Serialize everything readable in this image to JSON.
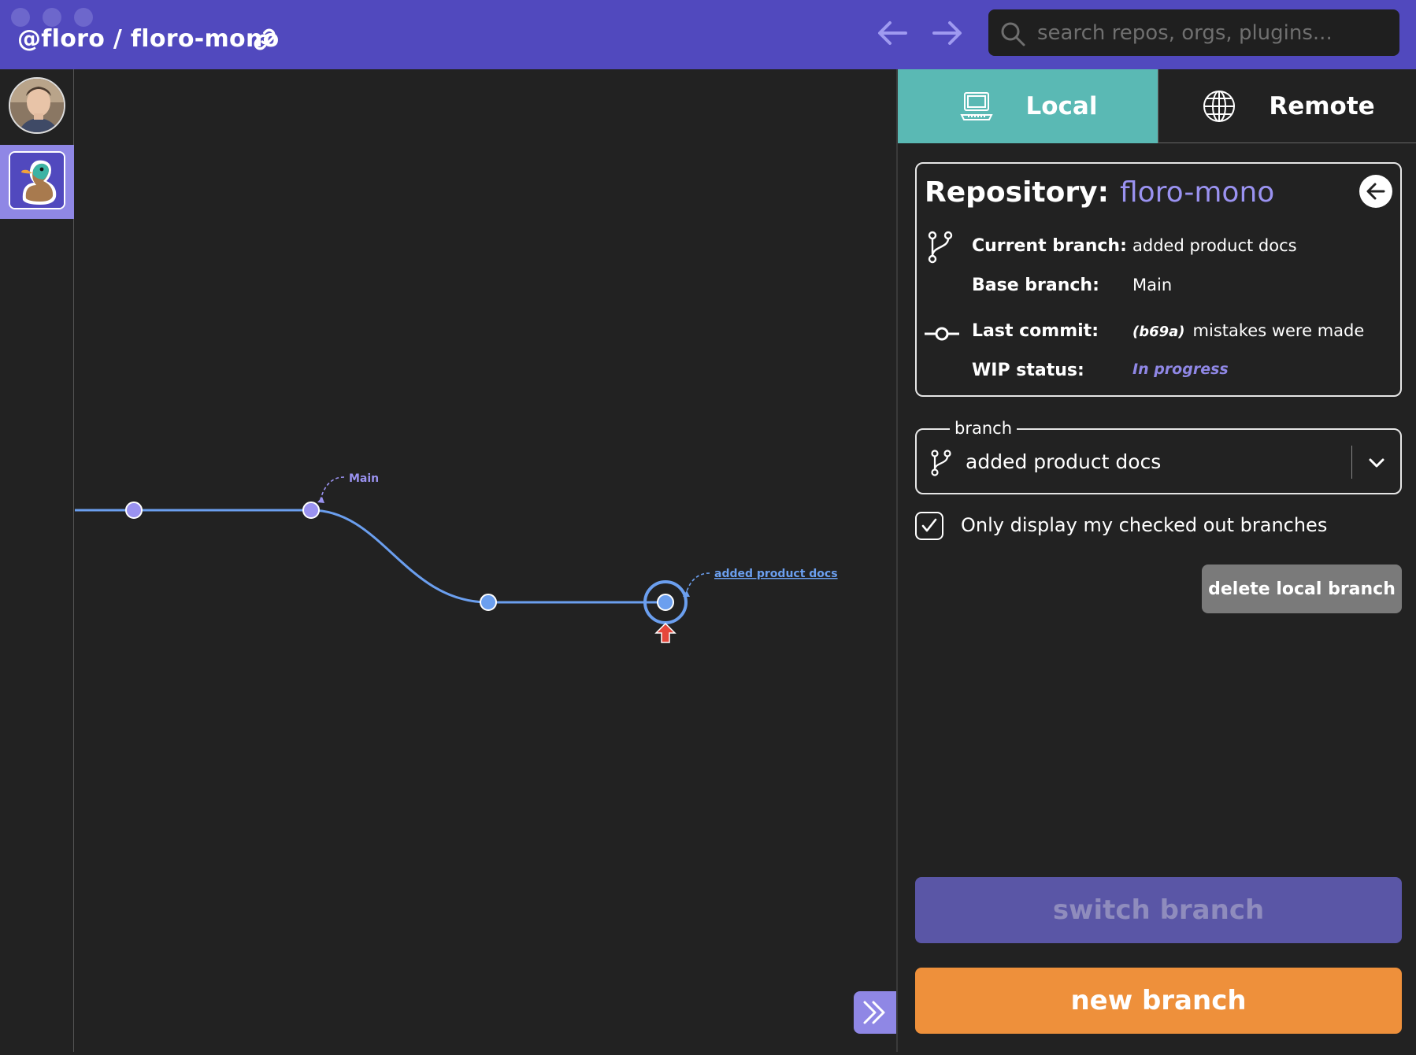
{
  "titlebar": {
    "repo_title": "@floro / floro-mono",
    "search_placeholder": "search repos, orgs, plugins..."
  },
  "colors": {
    "brand": "#5149be",
    "accent_purple": "#8f87e5",
    "local_tab": "#5ab9b4",
    "new_branch": "#ee903b",
    "graph_line": "#6b9fef",
    "head_arrow": "#e5473b"
  },
  "tabs": {
    "local_label": "Local",
    "remote_label": "Remote",
    "local_icon": "laptop-icon",
    "remote_icon": "globe-icon"
  },
  "repo_card": {
    "heading_label": "Repository:",
    "repo_name": "floro-mono",
    "current_branch_label": "Current branch:",
    "current_branch_value": "added product docs",
    "base_branch_label": "Base branch:",
    "base_branch_value": "Main",
    "last_commit_label": "Last commit:",
    "last_commit_sha": "(b69a)",
    "last_commit_message": "mistakes were made",
    "wip_label": "WIP status:",
    "wip_value": "In progress"
  },
  "branch_select": {
    "legend": "branch",
    "value": "added product docs"
  },
  "checkbox": {
    "label": "Only display my checked out branches",
    "checked": true
  },
  "buttons": {
    "delete_local": "delete local branch",
    "switch_branch": "switch branch",
    "new_branch": "new branch"
  },
  "graph": {
    "main_label": "Main",
    "branch_label": "added product docs"
  }
}
